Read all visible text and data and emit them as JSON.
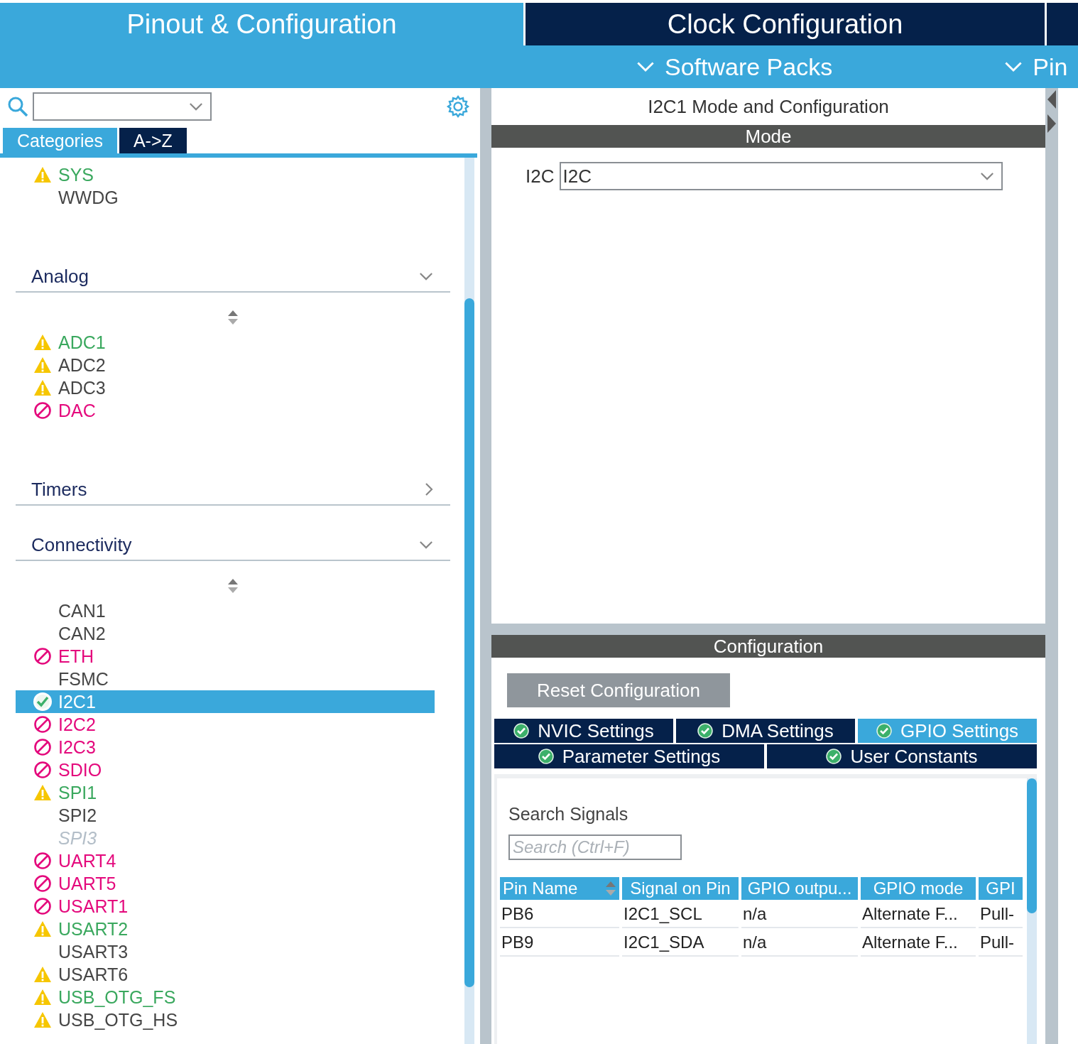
{
  "header": {
    "tabs": [
      {
        "label": "Pinout & Configuration",
        "selected": true
      },
      {
        "label": "Clock Configuration",
        "selected": false
      },
      {
        "selected": false
      }
    ],
    "menus": [
      {
        "label": "Software Packs"
      },
      {
        "label": "Pin"
      }
    ]
  },
  "sidebar": {
    "tabs": [
      {
        "label": "Categories",
        "selected": true
      },
      {
        "label": "A->Z",
        "selected": false
      }
    ],
    "top_items": [
      {
        "label": "SYS",
        "kind": "partial",
        "disabled": false,
        "selected": false
      },
      {
        "label": "WWDG",
        "kind": "plain",
        "disabled": false,
        "selected": false
      }
    ],
    "groups": [
      {
        "label": "Analog",
        "expanded": true,
        "items": [
          {
            "label": "ADC1",
            "kind": "partial",
            "disabled": false,
            "selected": false
          },
          {
            "label": "ADC2",
            "kind": "warning",
            "disabled": false,
            "selected": false
          },
          {
            "label": "ADC3",
            "kind": "warning",
            "disabled": false,
            "selected": false
          },
          {
            "label": "DAC",
            "kind": "blocked",
            "disabled": false,
            "selected": false
          }
        ]
      },
      {
        "label": "Timers",
        "expanded": false
      },
      {
        "label": "Connectivity",
        "expanded": true,
        "items": [
          {
            "label": "CAN1",
            "kind": "plain",
            "disabled": false,
            "selected": false
          },
          {
            "label": "CAN2",
            "kind": "plain",
            "disabled": false,
            "selected": false
          },
          {
            "label": "ETH",
            "kind": "blocked",
            "disabled": false,
            "selected": false
          },
          {
            "label": "FSMC",
            "kind": "plain",
            "disabled": false,
            "selected": false
          },
          {
            "label": "I2C1",
            "kind": "ok",
            "disabled": false,
            "selected": true
          },
          {
            "label": "I2C2",
            "kind": "blocked",
            "disabled": false,
            "selected": false
          },
          {
            "label": "I2C3",
            "kind": "blocked",
            "disabled": false,
            "selected": false
          },
          {
            "label": "SDIO",
            "kind": "blocked",
            "disabled": false,
            "selected": false
          },
          {
            "label": "SPI1",
            "kind": "partial",
            "disabled": false,
            "selected": false
          },
          {
            "label": "SPI2",
            "kind": "plain",
            "disabled": false,
            "selected": false
          },
          {
            "label": "SPI3",
            "kind": "plain",
            "disabled": true,
            "selected": false
          },
          {
            "label": "UART4",
            "kind": "blocked",
            "disabled": false,
            "selected": false
          },
          {
            "label": "UART5",
            "kind": "blocked",
            "disabled": false,
            "selected": false
          },
          {
            "label": "USART1",
            "kind": "blocked",
            "disabled": false,
            "selected": false
          },
          {
            "label": "USART2",
            "kind": "partial",
            "disabled": false,
            "selected": false
          },
          {
            "label": "USART3",
            "kind": "plain",
            "disabled": false,
            "selected": false
          },
          {
            "label": "USART6",
            "kind": "warning",
            "disabled": false,
            "selected": false
          },
          {
            "label": "USB_OTG_FS",
            "kind": "partial",
            "disabled": false,
            "selected": false
          },
          {
            "label": "USB_OTG_HS",
            "kind": "warning",
            "disabled": false,
            "selected": false
          }
        ]
      }
    ]
  },
  "panel": {
    "title": "I2C1 Mode and Configuration",
    "mode": {
      "header": "Mode",
      "field_label": "I2C",
      "value": "I2C"
    },
    "configuration": {
      "header": "Configuration",
      "reset_button": "Reset Configuration",
      "tab_rows": [
        [
          {
            "label": "NVIC Settings",
            "selected": false
          },
          {
            "label": "DMA Settings",
            "selected": false
          },
          {
            "label": "GPIO Settings",
            "selected": true
          }
        ],
        [
          {
            "label": "Parameter Settings",
            "selected": false
          },
          {
            "label": "User Constants",
            "selected": false
          }
        ]
      ],
      "search_label": "Search Signals",
      "search": {
        "placeholder": "Search (Ctrl+F)"
      },
      "table": {
        "columns": [
          "Pin Name",
          "Signal on Pin",
          "GPIO outpu...",
          "GPIO mode",
          "GPI"
        ],
        "rows": [
          [
            "PB6",
            "I2C1_SCL",
            "n/a",
            "Alternate F...",
            "Pull-"
          ],
          [
            "PB9",
            "I2C1_SDA",
            "n/a",
            "Alternate F...",
            "Pull-"
          ]
        ]
      }
    }
  }
}
